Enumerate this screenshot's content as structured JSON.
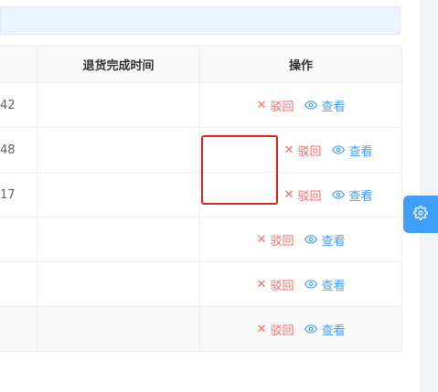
{
  "table": {
    "headers": {
      "c1": "",
      "return_complete_time": "退货完成时间",
      "operation": "操作"
    },
    "rows": [
      {
        "time_fragment": "42",
        "completion": "",
        "reject_label": "驳回",
        "view_label": "查看"
      },
      {
        "time_fragment": "48",
        "completion": "",
        "reject_label": "驳回",
        "view_label": "查看"
      },
      {
        "time_fragment": "17",
        "completion": "",
        "reject_label": "驳回",
        "view_label": "查看"
      },
      {
        "time_fragment": "",
        "completion": "",
        "reject_label": "驳回",
        "view_label": "查看"
      },
      {
        "time_fragment": "",
        "completion": "",
        "reject_label": "驳回",
        "view_label": "查看"
      },
      {
        "time_fragment": "",
        "completion": "",
        "reject_label": "驳回",
        "view_label": "查看"
      }
    ]
  },
  "icons": {
    "reject": "close-x-icon",
    "view": "eye-icon",
    "settings": "gear-icon"
  },
  "colors": {
    "reject": "#f56c6c",
    "view": "#409eff",
    "settings_bg": "#409eff",
    "highlight": "#e1251b",
    "info_bar": "#ecf5ff"
  }
}
